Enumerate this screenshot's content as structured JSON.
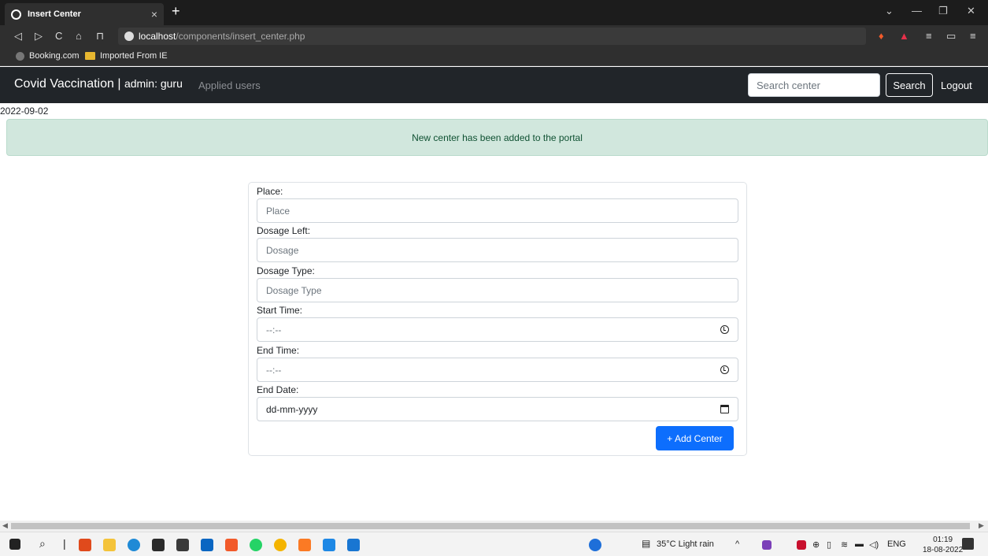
{
  "browser": {
    "tab_title": "Insert Center",
    "tab_close": "×",
    "new_tab": "+",
    "url_host": "localhost",
    "url_path": "/components/insert_center.php",
    "bookmarks": [
      "Booking.com",
      "Imported From IE"
    ]
  },
  "navbar": {
    "brand": "Covid Vaccination |",
    "admin": "admin: guru",
    "applied_users": "Applied users",
    "search_placeholder": "Search center",
    "search_button": "Search",
    "logout": "Logout"
  },
  "date": "2022-09-02",
  "alert": "New center has been added to the portal",
  "form": {
    "place_label": "Place:",
    "place_placeholder": "Place",
    "dosage_left_label": "Dosage Left:",
    "dosage_left_placeholder": "Dosage",
    "dosage_type_label": "Dosage Type:",
    "dosage_type_placeholder": "Dosage Type",
    "start_time_label": "Start Time:",
    "start_time_value": "--:--",
    "end_time_label": "End Time:",
    "end_time_value": "--:--",
    "end_date_label": "End Date:",
    "end_date_value": "dd-mm-yyyy",
    "submit": "+ Add Center"
  },
  "taskbar": {
    "weather": "35°C Light rain",
    "language": "ENG",
    "time": "01:19",
    "date": "18-08-2022"
  }
}
